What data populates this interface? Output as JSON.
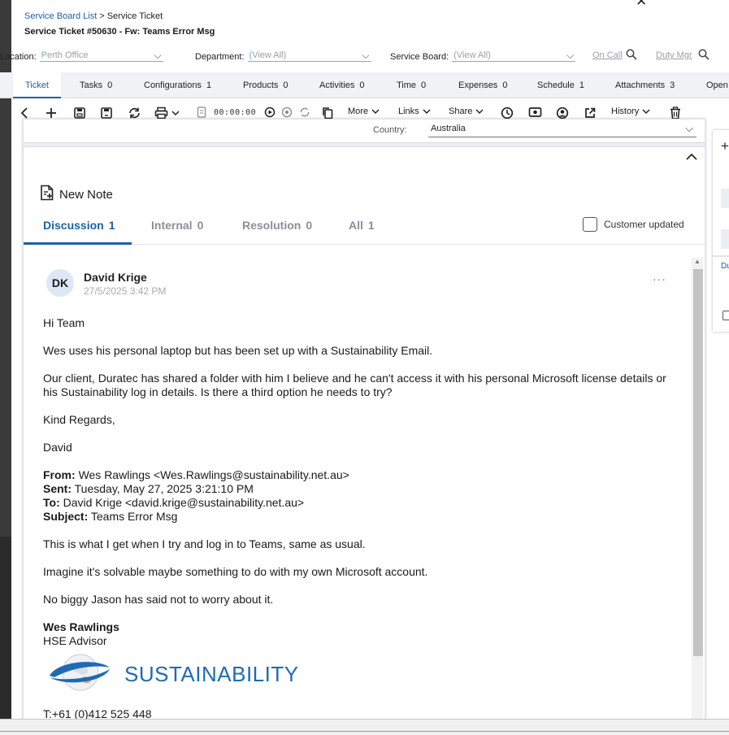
{
  "window": {
    "close_glyph": "✕"
  },
  "breadcrumb": {
    "list_link": "Service Board List",
    "separator": ">",
    "current": "Service Ticket"
  },
  "ticket": {
    "title": "Service Ticket #50630 - Fw: Teams Error Msg"
  },
  "filters": {
    "location_label": "Location:",
    "location_value": "Perth Office",
    "department_label": "Department:",
    "department_value": "(View All)",
    "board_label": "Service Board:",
    "board_value": "(View All)",
    "on_call": "On Call",
    "duty_mgr": "Duty Mgr"
  },
  "tabs": [
    {
      "label": "Ticket",
      "count": ""
    },
    {
      "label": "Tasks",
      "count": "0"
    },
    {
      "label": "Configurations",
      "count": "1"
    },
    {
      "label": "Products",
      "count": "0"
    },
    {
      "label": "Activities",
      "count": "0"
    },
    {
      "label": "Time",
      "count": "0"
    },
    {
      "label": "Expenses",
      "count": "0"
    },
    {
      "label": "Schedule",
      "count": "1"
    },
    {
      "label": "Attachments",
      "count": "3"
    },
    {
      "label": "Open",
      "count": ""
    }
  ],
  "toolbar": {
    "timer": "00:00:00",
    "more": "More",
    "links": "Links",
    "share": "Share",
    "history": "History"
  },
  "country": {
    "label": "Country:",
    "value": "Australia"
  },
  "new_note": {
    "label": "New Note"
  },
  "note_tabs": [
    {
      "label": "Discussion",
      "count": "1"
    },
    {
      "label": "Internal",
      "count": "0"
    },
    {
      "label": "Resolution",
      "count": "0"
    },
    {
      "label": "All",
      "count": "1"
    }
  ],
  "customer_updated": "Customer updated",
  "note": {
    "initials": "DK",
    "author": "David Krige",
    "time": "27/5/2025 3:42 PM",
    "greeting": "Hi Team",
    "p1": "Wes uses his personal laptop but has been set up with a Sustainability Email.",
    "p2": "Our client, Duratec has shared a folder with him I believe and he can't access it with his personal Microsoft license details or his Sustainability log in details. Is there a third option he needs to try?",
    "signoff": "Kind Regards,",
    "name": "David",
    "from_label": "From:",
    "from_value": "Wes Rawlings <Wes.Rawlings@sustainability.net.au>",
    "sent_label": "Sent:",
    "sent_value": "Tuesday, May 27, 2025 3:21:10 PM",
    "to_label": "To:",
    "to_value": "David Krige <david.krige@sustainability.net.au>",
    "subject_label": "Subject:",
    "subject_value": "Teams Error Msg",
    "p3": "This is what I get when I try and log in to Teams, same as usual.",
    "p4": "Imagine it's solvable maybe something to do with my own Microsoft account.",
    "p5": "No biggy Jason has said not to worry about it.",
    "sig_name": "Wes Rawlings",
    "sig_title": "HSE Advisor",
    "logo_text": "SUSTAINABILITY",
    "phone": "T:+61 (0)412 525 448"
  },
  "right_panel": {
    "plus": "+",
    "label": "Du"
  },
  "colors": {
    "accent": "#1f5fa8",
    "logo": "#1e6bb3"
  }
}
